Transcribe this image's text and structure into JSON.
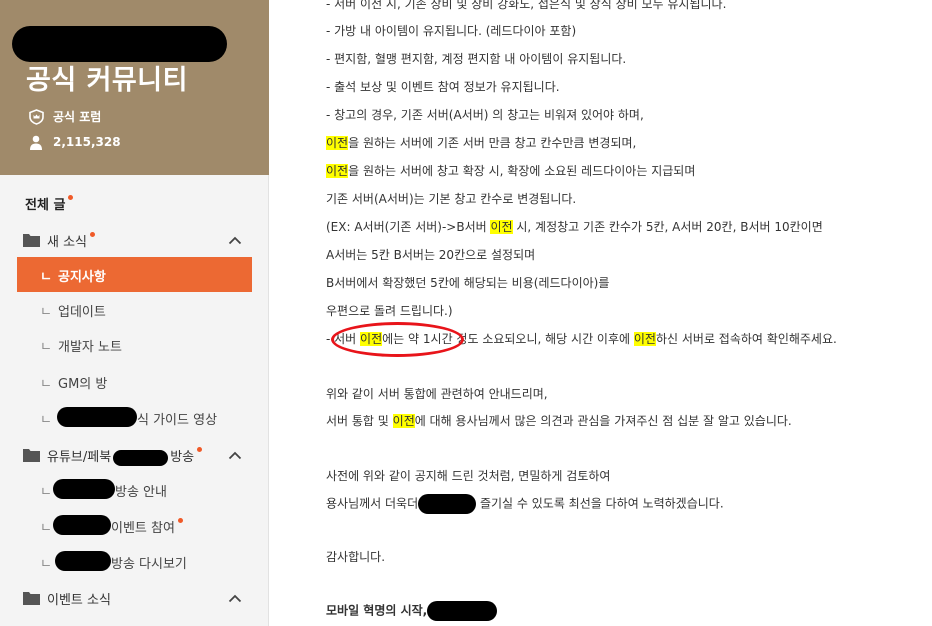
{
  "sidebar": {
    "community_title": "공식 커뮤니티",
    "forum_label": "공식 포럼",
    "member_count": "2,115,328",
    "all_posts": "전체 글",
    "categories": [
      {
        "label": "새 소식",
        "has_new": true,
        "expanded": true
      },
      {
        "label": "유튜브/페북",
        "label_suffix": "방송",
        "has_new": true,
        "expanded": true
      },
      {
        "label": "이벤트 소식",
        "has_new": false,
        "expanded": true
      }
    ],
    "news_items": [
      {
        "label": "공지사항",
        "active": true
      },
      {
        "label": "업데이트"
      },
      {
        "label": "개발자 노트"
      },
      {
        "label": "GM의 방"
      },
      {
        "label": "식 가이드 영상"
      }
    ],
    "broadcast_items": [
      {
        "label": "방송 안내"
      },
      {
        "label": "이벤트 참여",
        "has_new": true
      },
      {
        "label": "방송 다시보기"
      }
    ],
    "branch_glyph": "ㄴ"
  },
  "content": {
    "highlight_word": "이전",
    "lines": [
      "- 서버 이전 시, 기존 장비 및 장비 강화도, 접은식 및 장식 장비 모두 유지됩니다.",
      "- 가방 내 아이템이 유지됩니다. (레드다이아 포함)",
      "- 편지함, 혈맹 편지함, 계정 편지함 내 아이템이 유지됩니다.",
      "- 출석 보상 및 이벤트 참여 정보가 유지됩니다.",
      "- 창고의 경우, 기존 서버(A서버) 의 창고는 비워져 있어야 하며,",
      "을 원하는 서버에 기존 서버 만큼 창고 칸수만큼 변경되며,",
      "을 원하는 서버에 창고 확장 시, 확장에 소요된 레드다이아는 지급되며",
      "기존 서버(A서버)는 기본 창고 칸수로 변경됩니다.",
      "(EX: A서버(기존 서버)->B서버 ",
      " 시, 계정창고 기존 칸수가 5칸,  A서버 20칸, B서버 10칸이면",
      "A서버는 5칸 B서버는 20칸으로 설정되며",
      "B서버에서 확장했던 5칸에 해당되는 비용(레드다이아)를",
      "우편으로 돌려 드립니다.)",
      "- 서버 ",
      "에는 약 1시간 정도 소요되오니, 해당 시간 이후에 ",
      "하신 서버로 접속하여 확인해주세요.",
      "위와 같이 서버 통합에 관련하여 안내드리며,",
      "서버 통합 및 ",
      "에 대해 용사님께서 많은 의견과 관심을 가져주신 점 십분 잘 알고 있습니다.",
      "사전에 위와 같이 공지해 드린 것처럼, 면밀하게 검토하여",
      "용사님께서 더욱더",
      " 즐기실 수 있도록 최선을 다하여 노력하겠습니다.",
      "감사합니다.",
      "모바일 혁명의 시작,"
    ]
  },
  "colors": {
    "banner": "#a08a6a",
    "active_menu": "#ec6933",
    "new_dot": "#f05a28",
    "highlight": "#ffff00",
    "annotation": "#e8141a"
  }
}
